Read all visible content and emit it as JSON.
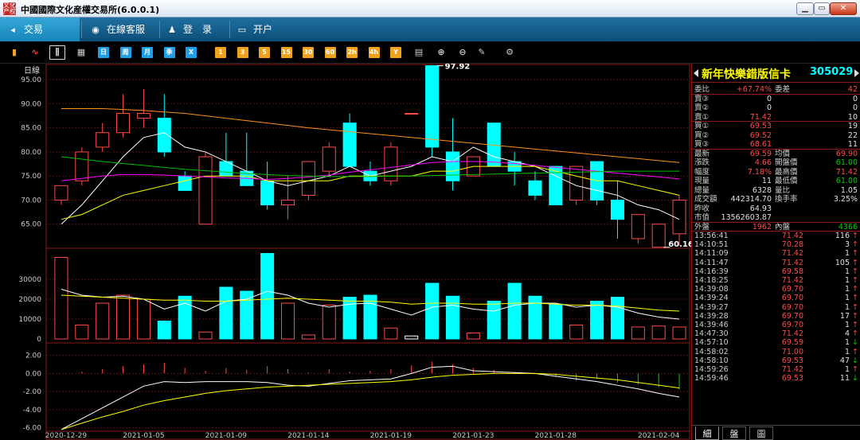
{
  "window": {
    "title": "中國國際文化産權交易所(6.0.0.1)",
    "logo_text": "文化产权"
  },
  "menu": [
    {
      "label": "交易",
      "icon": "back-arrow-icon",
      "glyph": "◂",
      "active": true
    },
    {
      "label": "在線客服",
      "icon": "eye-icon",
      "glyph": "◉"
    },
    {
      "label": "登　录",
      "icon": "user-icon",
      "glyph": "♟"
    },
    {
      "label": "开户",
      "icon": "monitor-icon",
      "glyph": "▭"
    }
  ],
  "toolbar": {
    "chart_types": [
      {
        "icon": "bar-chart-icon",
        "glyph": "▮"
      },
      {
        "icon": "line-chart-icon",
        "glyph": "∿"
      },
      {
        "icon": "candlestick-icon",
        "glyph": "⫼"
      },
      {
        "icon": "calendar-icon",
        "glyph": "▦"
      }
    ],
    "periods": [
      "日",
      "周",
      "月",
      "季",
      "X"
    ],
    "minutes": [
      "1",
      "3",
      "5",
      "15",
      "30",
      "60",
      "2h",
      "4h",
      "Y"
    ],
    "tools": [
      {
        "icon": "notes-icon",
        "glyph": "▤"
      },
      {
        "icon": "zoom-in-icon",
        "glyph": "⊕"
      },
      {
        "icon": "zoom-out-icon",
        "glyph": "⊖"
      },
      {
        "icon": "draw-pen-icon",
        "glyph": "✎"
      },
      {
        "icon": "gear-icon",
        "glyph": "⚙"
      }
    ]
  },
  "chart_data": {
    "type": "candlestick",
    "period_label": "日線",
    "dates_shown": [
      "2020-12-29",
      "2021-01-05",
      "2021-01-09",
      "2021-01-14",
      "2021-01-19",
      "2021-01-23",
      "2021-01-28",
      "2021-02-04"
    ],
    "high_label": "97.92",
    "low_label": "60.16",
    "price_axis": {
      "ticks": [
        "95.00",
        "90.00",
        "85.00",
        "80.00",
        "75.00",
        "70.00",
        "65.00"
      ],
      "range": [
        60,
        98
      ]
    },
    "volume_axis": {
      "ticks": [
        "30000",
        "20000",
        "10000",
        "0"
      ],
      "range": [
        0,
        44000
      ]
    },
    "macd_axis": {
      "ticks": [
        "2.00",
        "0.00",
        "-2.00",
        "-4.00",
        "-6.00"
      ],
      "range": [
        -6.3,
        2.5
      ]
    },
    "candles": [
      {
        "o": 70,
        "h": 73,
        "l": 69,
        "c": 73
      },
      {
        "o": 74,
        "h": 81,
        "l": 73,
        "c": 80
      },
      {
        "o": 81,
        "h": 86,
        "l": 80,
        "c": 84
      },
      {
        "o": 84,
        "h": 92,
        "l": 83,
        "c": 88
      },
      {
        "o": 87,
        "h": 93,
        "l": 85,
        "c": 88
      },
      {
        "o": 87,
        "h": 92,
        "l": 79,
        "c": 80
      },
      {
        "o": 75,
        "h": 76,
        "l": 72,
        "c": 72
      },
      {
        "o": 65,
        "h": 80,
        "l": 65,
        "c": 79
      },
      {
        "o": 78,
        "h": 84,
        "l": 75,
        "c": 75
      },
      {
        "o": 76,
        "h": 84,
        "l": 73,
        "c": 73
      },
      {
        "o": 74,
        "h": 78,
        "l": 68,
        "c": 69
      },
      {
        "o": 69,
        "h": 75,
        "l": 66,
        "c": 70
      },
      {
        "o": 71,
        "h": 78,
        "l": 70,
        "c": 78
      },
      {
        "o": 76,
        "h": 82,
        "l": 75,
        "c": 81
      },
      {
        "o": 86,
        "h": 88,
        "l": 77,
        "c": 77
      },
      {
        "o": 76,
        "h": 78,
        "l": 73,
        "c": 74
      },
      {
        "o": 74,
        "h": 82,
        "l": 73,
        "c": 81
      },
      {
        "o": 88,
        "h": 88,
        "l": 88,
        "c": 88
      },
      {
        "o": 97.9,
        "h": 97.9,
        "l": 79,
        "c": 81
      },
      {
        "o": 80,
        "h": 87,
        "l": 72,
        "c": 74
      },
      {
        "o": 75,
        "h": 79,
        "l": 75,
        "c": 79
      },
      {
        "o": 86,
        "h": 86,
        "l": 77,
        "c": 77
      },
      {
        "o": 78,
        "h": 80,
        "l": 73,
        "c": 76
      },
      {
        "o": 74,
        "h": 76,
        "l": 70,
        "c": 71
      },
      {
        "o": 77,
        "h": 77,
        "l": 69,
        "c": 69
      },
      {
        "o": 70,
        "h": 77,
        "l": 69,
        "c": 77
      },
      {
        "o": 78,
        "h": 78,
        "l": 69,
        "c": 70
      },
      {
        "o": 70,
        "h": 74,
        "l": 62,
        "c": 66
      },
      {
        "o": 62,
        "h": 67,
        "l": 61,
        "c": 67
      },
      {
        "o": 60.2,
        "h": 65,
        "l": 60.2,
        "c": 65
      },
      {
        "o": 63,
        "h": 71,
        "l": 60.5,
        "c": 70
      }
    ],
    "ma_series": [
      {
        "color": "#ffffff",
        "values": [
          65,
          69,
          74,
          79,
          83,
          84,
          81,
          80,
          78,
          76,
          74,
          73,
          74,
          75,
          77,
          75,
          76,
          77,
          79,
          78,
          81,
          79,
          78,
          77,
          75,
          73,
          72,
          71,
          69,
          68,
          66
        ]
      },
      {
        "color": "#ffff00",
        "values": [
          66,
          67,
          69,
          71,
          72,
          73,
          74,
          75,
          75,
          75,
          74,
          74,
          74,
          74,
          75,
          75,
          75,
          75,
          76,
          76,
          77,
          77,
          77,
          77,
          76,
          75,
          74,
          74,
          73,
          72,
          71
        ]
      },
      {
        "color": "#ff00ff",
        "values": [
          74,
          74.5,
          75,
          75.3,
          75.3,
          75.2,
          75,
          74.8,
          74.6,
          74.5,
          74.3,
          74.5,
          74.8,
          75.2,
          75.8,
          76.3,
          76.8,
          77.3,
          77.8,
          78.0,
          78.0,
          77.9,
          77.6,
          77.2,
          76.8,
          76.4,
          76.0,
          75.6,
          75.2,
          74.8,
          74.4
        ]
      },
      {
        "color": "#00c000",
        "values": [
          79,
          78.5,
          78,
          77.6,
          77.2,
          76.8,
          76.4,
          76.1,
          75.8,
          75.5,
          75.3,
          75.1,
          75,
          74.9,
          74.9,
          74.9,
          75,
          75,
          75.1,
          75.2,
          75.3,
          75.4,
          75.5,
          75.6,
          75.7,
          75.8,
          75.9,
          76,
          76,
          76,
          76
        ]
      },
      {
        "color": "#ff9020",
        "values": [
          89,
          89,
          89,
          88.8,
          88.6,
          88.3,
          88,
          87.5,
          87,
          86.5,
          86,
          85.5,
          85,
          84.6,
          84.2,
          83.8,
          83.4,
          83,
          82.6,
          82.2,
          81.8,
          81.4,
          81,
          80.6,
          80.2,
          79.8,
          79.4,
          79,
          78.6,
          78.2,
          77.8
        ]
      }
    ],
    "volumes": [
      41000,
      7000,
      18000,
      22000,
      20000,
      9000,
      21500,
      3500,
      26000,
      24000,
      43000,
      18000,
      2000,
      17000,
      21000,
      22000,
      5500,
      1500,
      28000,
      21500,
      3000,
      19000,
      28000,
      21500,
      17500,
      7000,
      19000,
      21000,
      6000,
      6500,
      6000
    ],
    "vol_ma": [
      {
        "color": "#ffffff",
        "values": [
          25000,
          22000,
          21000,
          21500,
          20000,
          15000,
          18000,
          14000,
          19000,
          20000,
          24000,
          22000,
          18000,
          16000,
          17500,
          18000,
          15000,
          12000,
          16000,
          17000,
          15000,
          14000,
          17000,
          18000,
          18000,
          16000,
          17000,
          16000,
          13000,
          11000,
          10000
        ]
      },
      {
        "color": "#ffff00",
        "values": [
          22000,
          21500,
          21000,
          20500,
          20000,
          19500,
          19500,
          19000,
          19000,
          19500,
          20000,
          20500,
          20000,
          19500,
          19000,
          19000,
          18500,
          17500,
          18000,
          18000,
          17500,
          17500,
          18000,
          18000,
          17500,
          17000,
          17000,
          16500,
          15500,
          14500,
          14000
        ]
      }
    ],
    "macd_bars": [
      0,
      0.2,
      0.5,
      0.8,
      1.0,
      1.2,
      0.6,
      0.3,
      0.6,
      0.4,
      0.8,
      0.5,
      0.1,
      0.5,
      0.2,
      0.3,
      0.5,
      0.9,
      1.3,
      1.0,
      0.6,
      0.4,
      0.2,
      -0.1,
      -0.4,
      -0.8,
      -0.6,
      -1.0,
      -1.2,
      -1.5,
      -1.8
    ],
    "macd_dif": [
      -6.2,
      -5.0,
      -3.8,
      -2.6,
      -1.4,
      -0.9,
      -1.0,
      -0.9,
      -0.9,
      -0.9,
      -1.0,
      -1.3,
      -1.4,
      -1.1,
      -0.8,
      -0.7,
      -0.6,
      0.0,
      0.7,
      0.8,
      0.3,
      0.2,
      0.1,
      0.0,
      -0.3,
      -0.6,
      -0.9,
      -1.3,
      -1.7,
      -2.2,
      -2.6
    ],
    "macd_dea": [
      -6.2,
      -5.5,
      -4.8,
      -4.2,
      -3.5,
      -3.0,
      -2.6,
      -2.2,
      -1.9,
      -1.7,
      -1.5,
      -1.4,
      -1.3,
      -1.2,
      -1.1,
      -1.0,
      -0.9,
      -0.7,
      -0.4,
      -0.2,
      -0.1,
      0.0,
      0.0,
      0.0,
      -0.1,
      -0.3,
      -0.5,
      -0.7,
      -1.0,
      -1.3,
      -1.6
    ]
  },
  "quote": {
    "name": "新年快樂錯版信卡",
    "code": "305029",
    "weibi": {
      "label": "委比",
      "value": "+67.74%",
      "label2": "委差",
      "value2": "42"
    },
    "sells": [
      {
        "label": "賣③",
        "price": "0",
        "vol": "0"
      },
      {
        "label": "賣②",
        "price": "0",
        "vol": "0"
      },
      {
        "label": "賣①",
        "price": "71.42",
        "vol": "10"
      }
    ],
    "buys": [
      {
        "label": "買①",
        "price": "69.53",
        "vol": "19"
      },
      {
        "label": "買②",
        "price": "69.52",
        "vol": "22"
      },
      {
        "label": "買③",
        "price": "68.61",
        "vol": "11"
      }
    ],
    "stats": [
      {
        "l1": "最新",
        "v1": "69.59",
        "c1": "red",
        "l2": "均價",
        "v2": "69.90",
        "c2": "red"
      },
      {
        "l1": "漲跌",
        "v1": "4.66",
        "c1": "red",
        "l2": "開盤價",
        "v2": "61.00",
        "c2": "green"
      },
      {
        "l1": "幅度",
        "v1": "7.18%",
        "c1": "red",
        "l2": "最高價",
        "v2": "71.42",
        "c2": "red"
      },
      {
        "l1": "現量",
        "v1": "11",
        "c1": "white",
        "l2": "最低價",
        "v2": "61.00",
        "c2": "green"
      },
      {
        "l1": "總量",
        "v1": "6328",
        "c1": "white",
        "l2": "量比",
        "v2": "1.05",
        "c2": "white"
      },
      {
        "l1": "成交額",
        "v1": "442314.70",
        "c1": "white",
        "l2": "換手率",
        "v2": "3.25%",
        "c2": "white"
      }
    ],
    "prev_close": {
      "label": "昨收",
      "value": "64.93"
    },
    "market_value": {
      "label": "市值",
      "value": "13562603.87"
    },
    "outer": {
      "label": "外盤",
      "value": "1962",
      "label2": "內盤",
      "value2": "4366"
    },
    "ticks": [
      {
        "t": "13:56:41",
        "p": "71.42",
        "v": "116",
        "d": "↑",
        "c": "red"
      },
      {
        "t": "14:10:51",
        "p": "70.28",
        "v": "3",
        "d": "↑",
        "c": "red"
      },
      {
        "t": "14:11:09",
        "p": "71.42",
        "v": "1",
        "d": "↑",
        "c": "red"
      },
      {
        "t": "14:11:47",
        "p": "71.42",
        "v": "105",
        "d": "↑",
        "c": "red"
      },
      {
        "t": "14:16:39",
        "p": "69.58",
        "v": "1",
        "d": "↑",
        "c": "red"
      },
      {
        "t": "14:18:25",
        "p": "71.42",
        "v": "1",
        "d": "↑",
        "c": "red"
      },
      {
        "t": "14:39:08",
        "p": "69.70",
        "v": "1",
        "d": "↑",
        "c": "red"
      },
      {
        "t": "14:39:24",
        "p": "69.70",
        "v": "1",
        "d": "↑",
        "c": "red"
      },
      {
        "t": "14:39:27",
        "p": "69.70",
        "v": "1",
        "d": "↑",
        "c": "red"
      },
      {
        "t": "14:39:28",
        "p": "69.70",
        "v": "17",
        "d": "↑",
        "c": "red"
      },
      {
        "t": "14:39:46",
        "p": "69.70",
        "v": "1",
        "d": "↑",
        "c": "red"
      },
      {
        "t": "14:47:30",
        "p": "71.42",
        "v": "4",
        "d": "↑",
        "c": "red"
      },
      {
        "t": "14:57:10",
        "p": "69.59",
        "v": "1",
        "d": "↓",
        "c": "green"
      },
      {
        "t": "14:58:02",
        "p": "71.00",
        "v": "1",
        "d": "↑",
        "c": "red"
      },
      {
        "t": "14:58:10",
        "p": "69.53",
        "v": "47",
        "d": "↓",
        "c": "green"
      },
      {
        "t": "14:59:26",
        "p": "71.42",
        "v": "1",
        "d": "↑",
        "c": "red"
      },
      {
        "t": "14:59:46",
        "p": "69.53",
        "v": "11",
        "d": "↓",
        "c": "green"
      }
    ],
    "tabs": [
      "細",
      "盤",
      "圖"
    ]
  }
}
